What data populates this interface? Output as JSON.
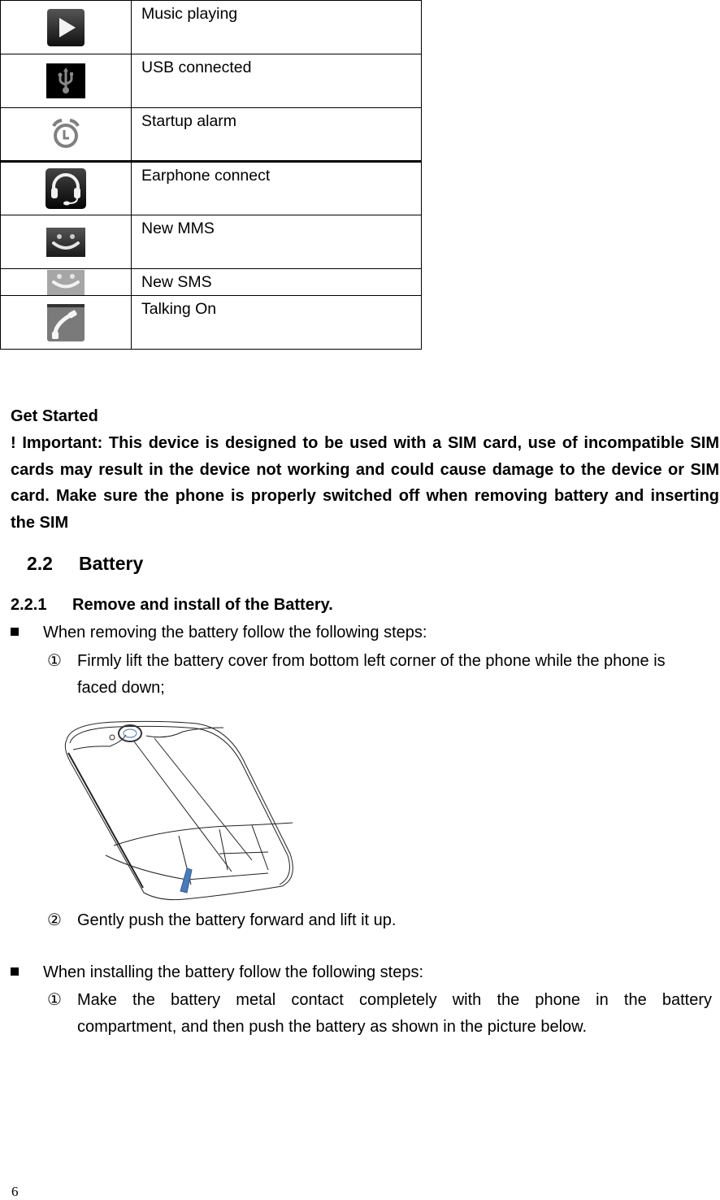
{
  "icon_table": {
    "rows": [
      {
        "icon": "play-icon",
        "label": "Music playing"
      },
      {
        "icon": "usb-icon",
        "label": "USB connected"
      },
      {
        "icon": "alarm-clock-icon",
        "label": "Startup alarm"
      },
      {
        "icon": "headset-icon",
        "label": "Earphone connect"
      },
      {
        "icon": "mms-smiley-icon",
        "label": "New MMS"
      },
      {
        "icon": "sms-smiley-icon",
        "label": "New SMS"
      },
      {
        "icon": "phone-handset-icon",
        "label": "Talking On"
      }
    ]
  },
  "get_started": {
    "heading": "Get Started",
    "important": "! Important: This device is designed to be used with a SIM card, use of incompatible SIM cards may result in the device not working and could cause damage to the device or SIM card. Make sure the phone is properly switched off when removing battery and inserting the SIM"
  },
  "section": {
    "number": "2.2",
    "title": "Battery"
  },
  "subsection": {
    "number": "2.2.1",
    "title": "Remove and install of the Battery."
  },
  "removing": {
    "intro": "When removing the battery follow the following steps:",
    "steps": [
      {
        "marker": "①",
        "line1": "Firmly lift the battery cover from bottom left corner of the phone while the phone is",
        "line2": "faced down;"
      },
      {
        "marker": "②",
        "line1": "Gently push the battery forward and lift it up."
      }
    ]
  },
  "installing": {
    "intro": "When installing the battery follow the following steps:",
    "steps": [
      {
        "marker": "①",
        "line1": "Make the battery metal contact completely with the phone in the battery",
        "line2": "compartment, and then push the battery as shown in the picture below."
      }
    ]
  },
  "figure": {
    "description": "phone-back-cover-removal-illustration",
    "accent_color": "#4a7ab8"
  },
  "page_number": "6"
}
